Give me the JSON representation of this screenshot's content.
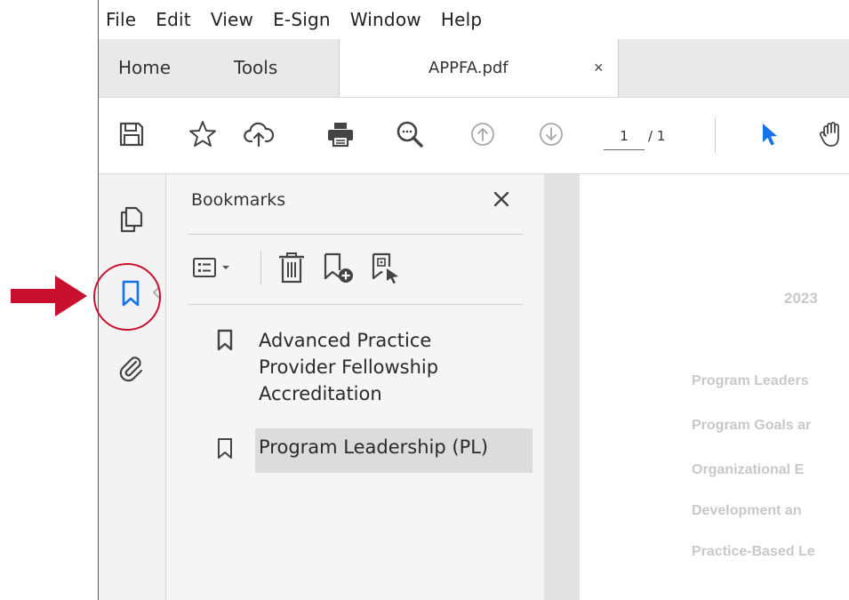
{
  "menu": {
    "items": [
      "File",
      "Edit",
      "View",
      "E-Sign",
      "Window",
      "Help"
    ]
  },
  "tabs": {
    "home": "Home",
    "tools": "Tools",
    "document": {
      "title": "APPFA.pdf",
      "close_glyph": "×"
    }
  },
  "toolbar": {
    "icons": [
      "save-icon",
      "star-icon",
      "cloud-upload-icon",
      "print-icon",
      "zoom-out-icon",
      "page-up-icon",
      "page-down-icon",
      "select-arrow-icon",
      "hand-icon"
    ],
    "page_current": "1",
    "page_total": "/ 1"
  },
  "left_rail": {
    "icons": [
      "pages-icon",
      "bookmark-icon",
      "attachment-icon"
    ],
    "active": "bookmark-icon"
  },
  "bookmarks_panel": {
    "title": "Bookmarks",
    "tools": [
      "options-list-icon",
      "delete-icon",
      "new-bookmark-icon",
      "new-bookmark-from-structure-icon"
    ],
    "items": [
      {
        "label": "Advanced Practice\nProvider Fellowship\nAccreditation",
        "selected": false
      },
      {
        "label": "Program Leadership (PL)",
        "selected": true
      }
    ]
  },
  "document": {
    "year_fragment": "2023",
    "toc_fragments": [
      "Program Leaders",
      "Program Goals ar",
      "Organizational E",
      "Development an",
      "Practice-Based Le"
    ]
  },
  "colors": {
    "accent_blue": "#1473e6",
    "callout_red": "#c8102e",
    "selection_gray": "#dcdcdc"
  }
}
